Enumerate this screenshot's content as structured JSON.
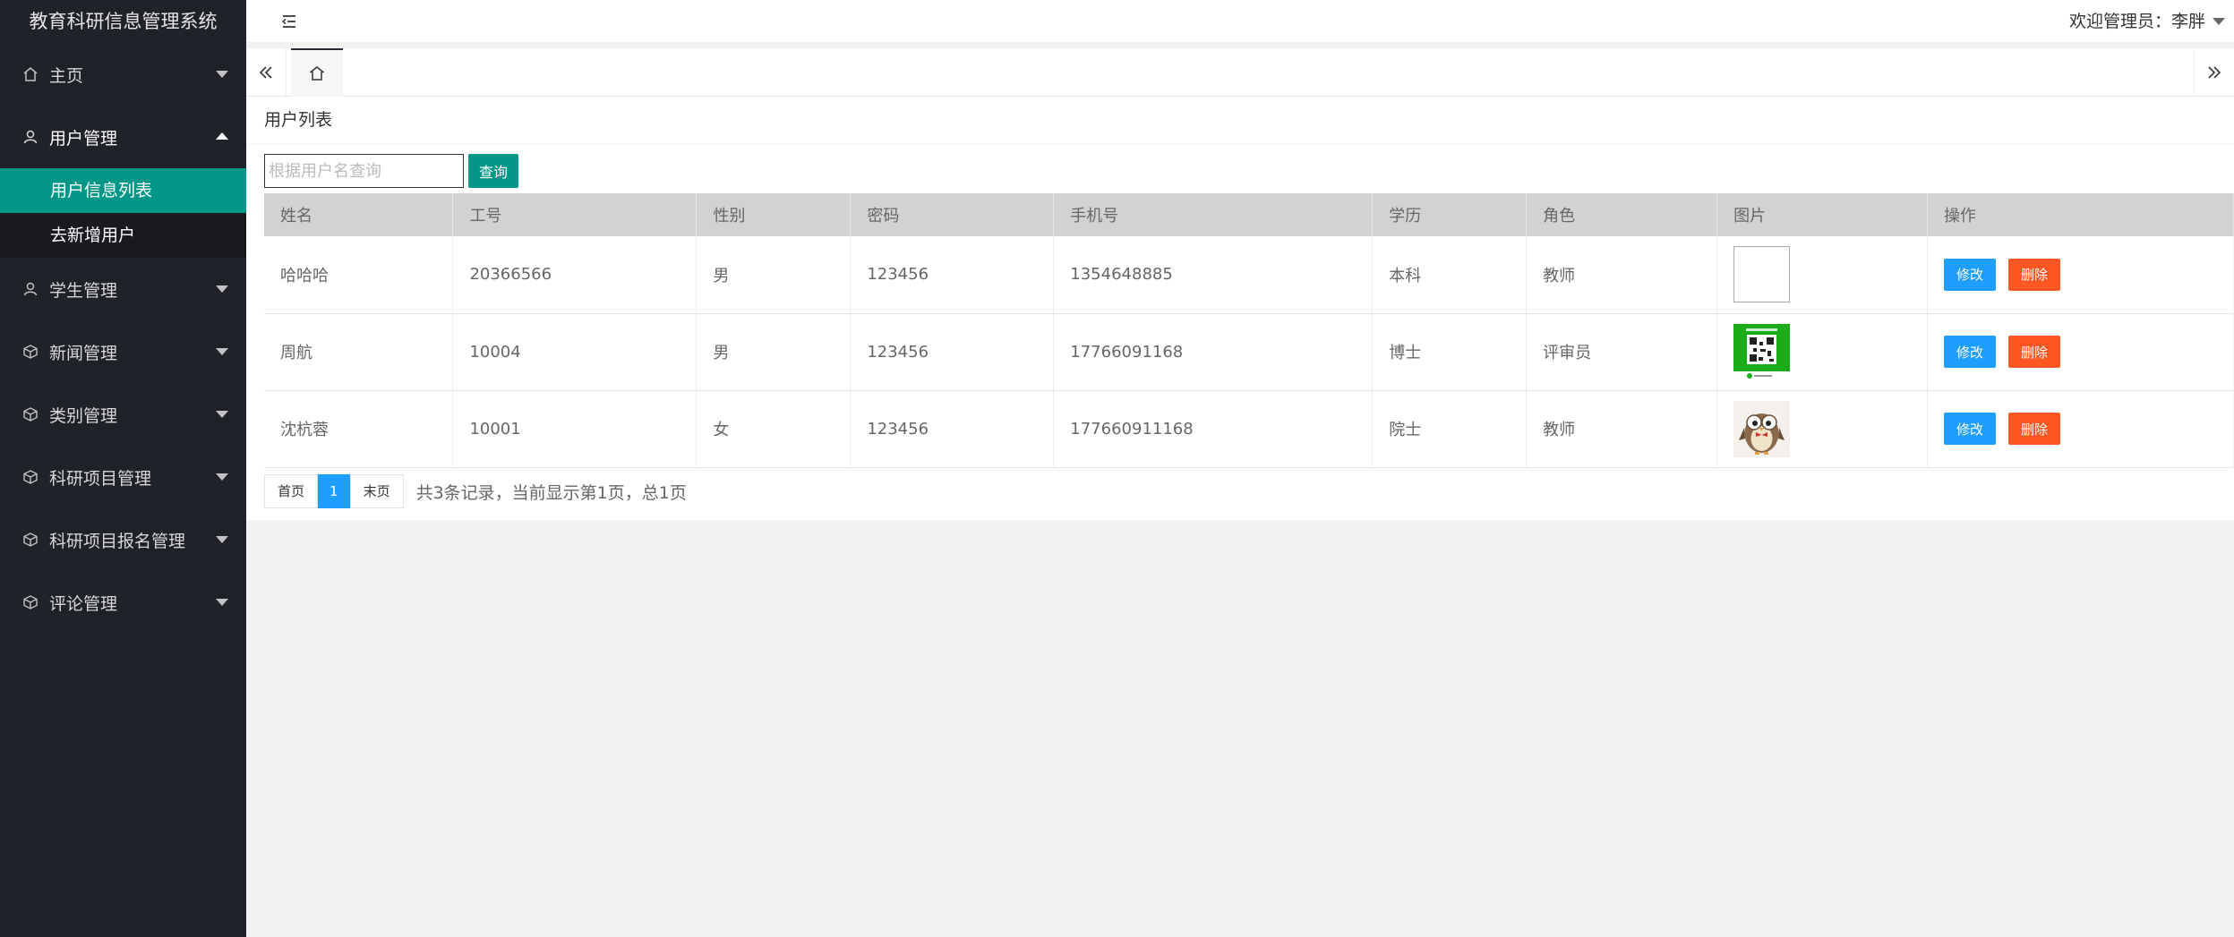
{
  "app": {
    "title": "教育科研信息管理系统"
  },
  "sidebar": {
    "items": [
      {
        "label": "主页",
        "icon": "home-icon",
        "expanded": false
      },
      {
        "label": "用户管理",
        "icon": "user-icon",
        "expanded": true,
        "children": [
          {
            "label": "用户信息列表",
            "active": true
          },
          {
            "label": "去新增用户",
            "active": false
          }
        ]
      },
      {
        "label": "学生管理",
        "icon": "user-icon",
        "expanded": false
      },
      {
        "label": "新闻管理",
        "icon": "cube-icon",
        "expanded": false
      },
      {
        "label": "类别管理",
        "icon": "cube-icon",
        "expanded": false
      },
      {
        "label": "科研项目管理",
        "icon": "cube-icon",
        "expanded": false
      },
      {
        "label": "科研项目报名管理",
        "icon": "cube-icon",
        "expanded": false
      },
      {
        "label": "评论管理",
        "icon": "cube-icon",
        "expanded": false
      }
    ]
  },
  "header": {
    "user_label": "欢迎管理员：李胖"
  },
  "page": {
    "card_title": "用户列表"
  },
  "search": {
    "placeholder": "根据用户名查询",
    "value": "",
    "button_label": "查询"
  },
  "table": {
    "columns": [
      "姓名",
      "工号",
      "性别",
      "密码",
      "手机号",
      "学历",
      "角色",
      "图片",
      "操作"
    ],
    "rows": [
      {
        "name": "哈哈哈",
        "id": "20366566",
        "gender": "男",
        "password": "123456",
        "phone": "1354648885",
        "education": "本科",
        "role": "教师",
        "image": "broken-image"
      },
      {
        "name": "周航",
        "id": "10004",
        "gender": "男",
        "password": "123456",
        "phone": "17766091168",
        "education": "博士",
        "role": "评审员",
        "image": "qr-code-image"
      },
      {
        "name": "沈杭蓉",
        "id": "10001",
        "gender": "女",
        "password": "123456",
        "phone": "177660911168",
        "education": "院士",
        "role": "教师",
        "image": "owl-image"
      }
    ],
    "edit_label": "修改",
    "delete_label": "删除"
  },
  "pagination": {
    "first_label": "首页",
    "current_page": "1",
    "last_label": "末页",
    "info": "共3条记录，当前显示第1页，总1页"
  },
  "colors": {
    "sidebar_bg": "#20222a",
    "accent": "#009688",
    "edit": "#1e9fff",
    "delete": "#ff5722"
  }
}
